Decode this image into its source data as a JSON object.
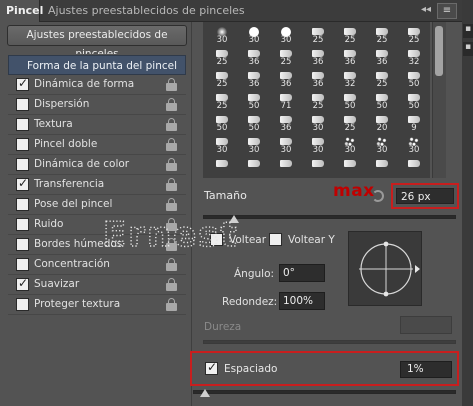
{
  "tabs": {
    "active": "Pincel",
    "other": "Ajustes preestablecidos de pinceles",
    "collapse_glyph": "◂◂",
    "menu_glyph": "≡"
  },
  "left_panel": {
    "presets_button": "Ajustes preestablecidos de pinceles",
    "header": "Forma de la punta del pincel",
    "items": [
      {
        "label": "Dinámica de forma",
        "checked": true
      },
      {
        "label": "Dispersión",
        "checked": false
      },
      {
        "label": "Textura",
        "checked": false
      },
      {
        "label": "Pincel doble",
        "checked": false
      },
      {
        "label": "Dinámica de color",
        "checked": false
      },
      {
        "label": "Transferencia",
        "checked": true
      },
      {
        "label": "Pose del pincel",
        "checked": false
      },
      {
        "label": "Ruido",
        "checked": false
      },
      {
        "label": "Bordes húmedos",
        "checked": false
      },
      {
        "label": "Concentración",
        "checked": false
      },
      {
        "label": "Suavizar",
        "checked": true
      },
      {
        "label": "Proteger textura",
        "checked": false
      }
    ]
  },
  "brush_grid": {
    "rows": [
      [
        {
          "n": "30",
          "s": "soft-round"
        },
        {
          "n": "30",
          "s": "round"
        },
        {
          "n": "30",
          "s": "round"
        },
        {
          "n": "25",
          "s": "brush"
        },
        {
          "n": "25",
          "s": "brush"
        },
        {
          "n": "25",
          "s": "brush"
        },
        {
          "n": "25",
          "s": "brush"
        }
      ],
      [
        {
          "n": "25",
          "s": "brush"
        },
        {
          "n": "36",
          "s": "brush"
        },
        {
          "n": "25",
          "s": "brush"
        },
        {
          "n": "36",
          "s": "brush"
        },
        {
          "n": "36",
          "s": "brush"
        },
        {
          "n": "36",
          "s": "brush"
        },
        {
          "n": "32",
          "s": "brush"
        }
      ],
      [
        {
          "n": "25",
          "s": "brush"
        },
        {
          "n": "36",
          "s": "brush"
        },
        {
          "n": "36",
          "s": "brush"
        },
        {
          "n": "36",
          "s": "brush"
        },
        {
          "n": "32",
          "s": "brush"
        },
        {
          "n": "25",
          "s": "brush"
        },
        {
          "n": "50",
          "s": "brush"
        }
      ],
      [
        {
          "n": "25",
          "s": "brush"
        },
        {
          "n": "50",
          "s": "brush"
        },
        {
          "n": "71",
          "s": "brush"
        },
        {
          "n": "25",
          "s": "brush"
        },
        {
          "n": "50",
          "s": "brush"
        },
        {
          "n": "50",
          "s": "brush"
        },
        {
          "n": "50",
          "s": "brush"
        }
      ],
      [
        {
          "n": "50",
          "s": "brush"
        },
        {
          "n": "50",
          "s": "brush"
        },
        {
          "n": "36",
          "s": "brush"
        },
        {
          "n": "30",
          "s": "brush"
        },
        {
          "n": "25",
          "s": "brush"
        },
        {
          "n": "20",
          "s": "brush"
        },
        {
          "n": "9",
          "s": "brush"
        }
      ],
      [
        {
          "n": "30",
          "s": "brush"
        },
        {
          "n": "30",
          "s": "brush"
        },
        {
          "n": "30",
          "s": "brush"
        },
        {
          "n": "30",
          "s": "brush"
        },
        {
          "n": "30",
          "s": "splatter"
        },
        {
          "n": "30",
          "s": "splatter"
        },
        {
          "n": "30",
          "s": "splatter"
        }
      ],
      [
        {
          "n": "",
          "s": "brush"
        },
        {
          "n": "",
          "s": "brush"
        },
        {
          "n": "",
          "s": "brush"
        },
        {
          "n": "",
          "s": "brush"
        },
        {
          "n": "",
          "s": "brush"
        },
        {
          "n": "",
          "s": "brush"
        },
        {
          "n": "",
          "s": "brush"
        }
      ]
    ]
  },
  "size": {
    "label": "Tamaño",
    "value": "26 px",
    "annotation": "max",
    "slider_fraction": 0.1
  },
  "flip": {
    "x_label": "Voltear X",
    "y_label": "Voltear Y"
  },
  "angle": {
    "label": "Ángulo:",
    "value": "0°"
  },
  "roundness": {
    "label": "Redondez:",
    "value": "100%"
  },
  "hardness": {
    "label": "Dureza"
  },
  "spacing": {
    "label": "Espaciado",
    "value": "1%",
    "checked": true,
    "slider_fraction": 0.01
  },
  "watermark": "Ernest",
  "icons": {
    "lock": "lock-icon",
    "reset": "reset-icon",
    "menu": "panel-menu-icon"
  },
  "colors": {
    "panel": "#535353",
    "highlight_red": "#c81e1e",
    "header_blue": "#42526a"
  }
}
